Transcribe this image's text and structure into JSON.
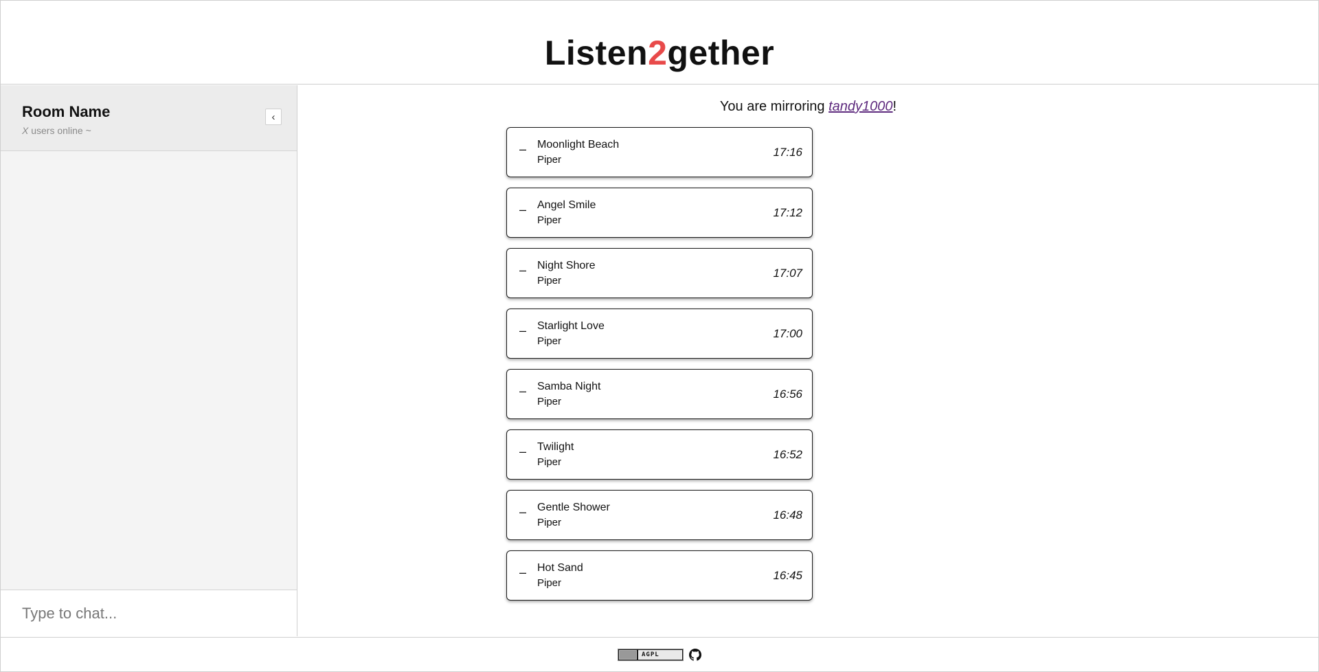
{
  "header": {
    "logo_part1": "Listen",
    "logo_part2": "2",
    "logo_part3": "gether",
    "accent_color": "#e84a4a"
  },
  "sidebar": {
    "room_name": "Room Name",
    "users_x": "X",
    "users_text": " users online ~",
    "collapse_icon": "chevron-left-icon",
    "collapse_glyph": "‹",
    "chat_placeholder": "Type to chat..."
  },
  "main": {
    "mirror_prefix": "You are mirroring ",
    "mirror_user": "tandy1000",
    "mirror_suffix": "!",
    "link_color": "#5e2a7e",
    "tracks": [
      {
        "dash": "–",
        "title": "Moonlight Beach",
        "artist": "Piper",
        "time": "17:16"
      },
      {
        "dash": "–",
        "title": "Angel Smile",
        "artist": "Piper",
        "time": "17:12"
      },
      {
        "dash": "–",
        "title": "Night Shore",
        "artist": "Piper",
        "time": "17:07"
      },
      {
        "dash": "–",
        "title": "Starlight Love",
        "artist": "Piper",
        "time": "17:00"
      },
      {
        "dash": "–",
        "title": "Samba Night",
        "artist": "Piper",
        "time": "16:56"
      },
      {
        "dash": "–",
        "title": "Twilight",
        "artist": "Piper",
        "time": "16:52"
      },
      {
        "dash": "–",
        "title": "Gentle Shower",
        "artist": "Piper",
        "time": "16:48"
      },
      {
        "dash": "–",
        "title": "Hot Sand",
        "artist": "Piper",
        "time": "16:45"
      }
    ]
  },
  "footer": {
    "license_text": "AGPL",
    "license_icon": "agpl-badge-icon",
    "repo_icon": "github-icon"
  }
}
